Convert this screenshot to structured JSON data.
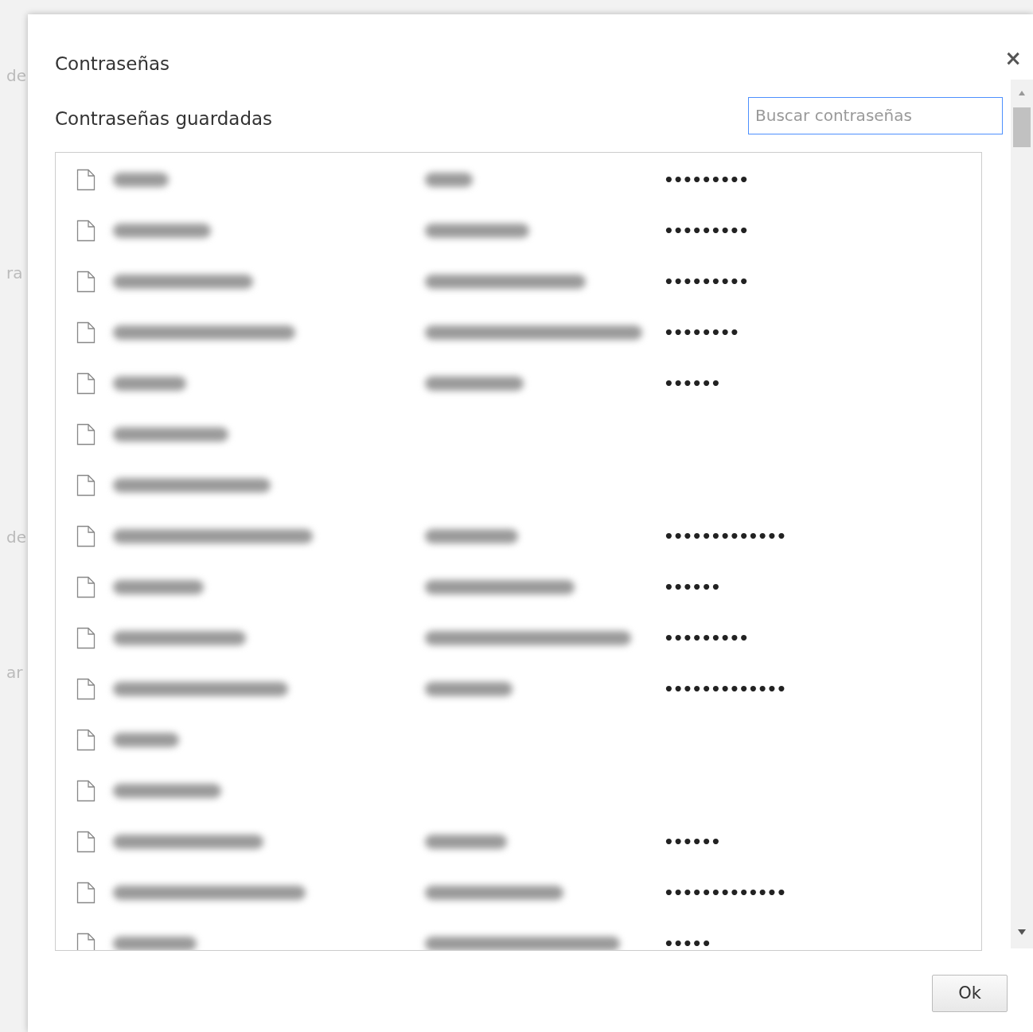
{
  "background_texts": [
    "de",
    "ra",
    "de",
    "ar"
  ],
  "dialog": {
    "title": "Contraseñas",
    "close": "×",
    "subtitle": "Contraseñas guardadas",
    "search": {
      "placeholder": "Buscar contraseñas"
    },
    "rows": [
      {
        "site_blurred": true,
        "username_blurred": true,
        "password": "•••••••••"
      },
      {
        "site_blurred": true,
        "username_blurred": true,
        "password": "•••••••••"
      },
      {
        "site_blurred": true,
        "username_blurred": true,
        "password": "•••••••••"
      },
      {
        "site_blurred": true,
        "username_blurred": true,
        "password": "••••••••"
      },
      {
        "site_blurred": true,
        "username_blurred": true,
        "password": "••••••"
      },
      {
        "site_blurred": true,
        "username_blurred": false
      },
      {
        "site_blurred": true,
        "username_blurred": false
      },
      {
        "site_blurred": true,
        "username_blurred": true,
        "password": "•••••••••••••"
      },
      {
        "site_blurred": true,
        "username_blurred": true,
        "password": "••••••"
      },
      {
        "site_blurred": true,
        "username_blurred": true,
        "password": "•••••••••"
      },
      {
        "site_blurred": true,
        "username_blurred": true,
        "password": "•••••••••••••"
      },
      {
        "site_blurred": true,
        "username_blurred": false
      },
      {
        "site_blurred": true,
        "username_blurred": false
      },
      {
        "site_blurred": true,
        "username_blurred": true,
        "password": "••••••"
      },
      {
        "site_blurred": true,
        "username_blurred": true,
        "password": "•••••••••••••"
      },
      {
        "site_blurred": true,
        "username_blurred": true,
        "password": "•••••"
      }
    ],
    "ok_button": "Ok"
  }
}
